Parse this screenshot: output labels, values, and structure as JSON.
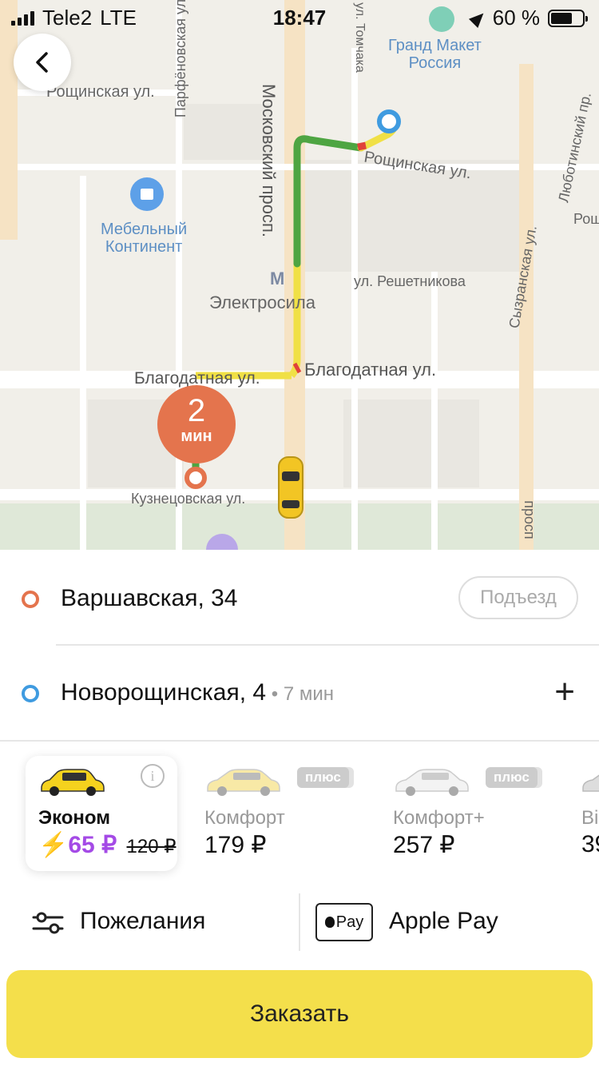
{
  "status_bar": {
    "carrier": "Tele2",
    "network": "LTE",
    "time": "18:47",
    "battery_percent": "60 %"
  },
  "map": {
    "streets": {
      "roshchinskaya_left": "Рощинская ул.",
      "roshchinskaya_right": "Рощинская ул.",
      "moskovsky": "Московский просп.",
      "blagodatnaya_left": "Благодатная ул.",
      "blagodatnaya_right": "Благодатная ул.",
      "reshetnikova": "ул. Решетникова",
      "kuznetsovskaya": "Кузнецовская ул.",
      "parfenovskaya": "Парфёновская ул.",
      "syzranskaya": "Сызранская ул.",
      "lyubotinsky": "Люботинский пр.",
      "tomchaka": "ул. Томчака",
      "rosh_edge": "Рощ",
      "prosp_edge": "просп"
    },
    "pois": {
      "grand_maket_1": "Гранд Макет",
      "grand_maket_2": "Россия",
      "mebelny_1": "Мебельный",
      "mebelny_2": "Континент",
      "metro": "Электросила"
    },
    "eta": {
      "value": "2",
      "unit": "мин"
    }
  },
  "route": {
    "from": {
      "address": "Варшавская, 34",
      "entrance_label": "Подъезд"
    },
    "to": {
      "address": "Новорощинская, 4",
      "duration": " • 7 мин"
    },
    "add_label": "+"
  },
  "tariffs": [
    {
      "name": "Эконом",
      "price": "65 ₽",
      "old_price": "120 ₽",
      "selected": true,
      "info": "i"
    },
    {
      "name": "Комфорт",
      "price": "179 ₽",
      "badge": "плюс"
    },
    {
      "name": "Комфорт+",
      "price": "257 ₽",
      "badge": "плюс"
    },
    {
      "name": "Bi",
      "price": "39"
    }
  ],
  "options": {
    "wishes_label": "Пожелания",
    "payment_label": "Apple Pay",
    "pay_logo_text": "Pay"
  },
  "order_button": "Заказать",
  "colors": {
    "accent_yellow": "#f4df4b",
    "origin_orange": "#e4744d",
    "dest_blue": "#3f9be0",
    "promo_purple": "#a44ae6"
  }
}
